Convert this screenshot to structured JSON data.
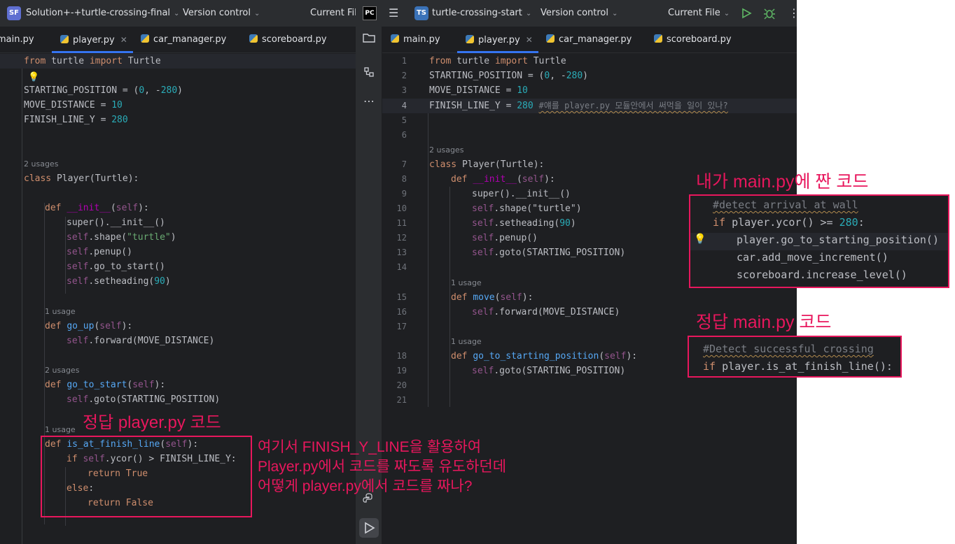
{
  "left": {
    "project_badge": "SF",
    "project_name": "Solution+-+turtle-crossing-final",
    "version_control": "Version control",
    "current_file": "Current Fil",
    "tabs": [
      {
        "label": "main.py"
      },
      {
        "label": "player.py",
        "active": true
      },
      {
        "label": "car_manager.py"
      },
      {
        "label": "scoreboard.py"
      }
    ],
    "hints": {
      "usages_2a": "2 usages",
      "usage_1": "1 usage",
      "usages_2b": "2 usages",
      "usage_1b": "1 usage"
    },
    "code": {
      "l1_a": "from",
      "l1_b": " turtle ",
      "l1_c": "import",
      "l1_d": " Turtle",
      "l3_a": "STARTING_POSITION = (",
      "l3_b": "0",
      "l3_c": ", -",
      "l3_d": "280",
      "l3_e": ")",
      "l4_a": "MOVE_DISTANCE = ",
      "l4_b": "10",
      "l5_a": "FINISH_LINE_Y = ",
      "l5_b": "280",
      "l8_a": "class",
      "l8_b": " Player(Turtle):",
      "l10_a": "def",
      "l10_b": "__init__",
      "l10_c": "(",
      "l10_d": "self",
      "l10_e": "):",
      "l11": "super().__init__()",
      "l12_a": "self",
      "l12_b": ".shape(",
      "l12_c": "\"turtle\"",
      "l12_d": ")",
      "l13_a": "self",
      "l13_b": ".penup()",
      "l14_a": "self",
      "l14_b": ".go_to_start()",
      "l15_a": "self",
      "l15_b": ".setheading(",
      "l15_c": "90",
      "l15_d": ")",
      "l17_a": "def",
      "l17_b": "go_up",
      "l17_c": "(",
      "l17_d": "self",
      "l17_e": "):",
      "l18_a": "self",
      "l18_b": ".forward(MOVE_DISTANCE)",
      "l20_a": "def",
      "l20_b": "go_to_start",
      "l20_c": "(",
      "l20_d": "self",
      "l20_e": "):",
      "l21_a": "self",
      "l21_b": ".goto(STARTING_POSITION)",
      "l23_a": "def",
      "l23_b": "is_at_finish_line",
      "l23_c": "(",
      "l23_d": "self",
      "l23_e": "):",
      "l24_a": "if",
      "l24_b": "self",
      "l24_c": ".ycor() > FINISH_LINE_Y:",
      "l25_a": "return",
      "l25_b": "True",
      "l26_a": "else",
      "l27_a": "return",
      "l27_b": "False"
    }
  },
  "right": {
    "app_badge": "PC",
    "project_badge": "TS",
    "project_name": "turtle-crossing-start",
    "version_control": "Version control",
    "current_file": "Current File",
    "tabs": [
      {
        "label": "main.py"
      },
      {
        "label": "player.py",
        "active": true
      },
      {
        "label": "car_manager.py"
      },
      {
        "label": "scoreboard.py"
      }
    ],
    "line_numbers": [
      "1",
      "2",
      "3",
      "4",
      "5",
      "6",
      "7",
      "8",
      "9",
      "10",
      "11",
      "12",
      "13",
      "14",
      "15",
      "16",
      "17",
      "18",
      "19",
      "20",
      "21"
    ],
    "hints": {
      "usages_2": "2 usages",
      "usage_1a": "1 usage",
      "usage_1b": "1 usage"
    },
    "code": {
      "l1_a": "from",
      "l1_b": " turtle ",
      "l1_c": "import",
      "l1_d": " Turtle",
      "l2_a": "STARTING_POSITION = (",
      "l2_b": "0",
      "l2_c": ", -",
      "l2_d": "280",
      "l2_e": ")",
      "l3_a": "MOVE_DISTANCE = ",
      "l3_b": "10",
      "l4_a": "FINISH_LINE_Y = ",
      "l4_b": "280",
      "l4_c": "#얘를 player.py 모듈안에서 써먹을 일이 있나?",
      "l7_a": "class",
      "l7_b": " Player(Turtle):",
      "l8_a": "def",
      "l8_b": "__init__",
      "l8_c": "(",
      "l8_d": "self",
      "l8_e": "):",
      "l9": "super().__init__()",
      "l10_a": "self",
      "l10_b": ".shape(\"turtle\")",
      "l11_a": "self",
      "l11_b": ".setheading(",
      "l11_c": "90",
      "l11_d": ")",
      "l12_a": "self",
      "l12_b": ".penup()",
      "l13_a": "self",
      "l13_b": ".goto(STARTING_POSITION)",
      "l15_a": "def",
      "l15_b": "move",
      "l15_c": "(",
      "l15_d": "self",
      "l15_e": "):",
      "l16_a": "self",
      "l16_b": ".forward(MOVE_DISTANCE)",
      "l18_a": "def",
      "l18_b": "go_to_starting_position",
      "l18_c": "(",
      "l18_d": "self",
      "l18_e": "):",
      "l19_a": "self",
      "l19_b": ".goto(STARTING_POSITION)"
    }
  },
  "annotations": {
    "answer_player_label": "정답 player.py 코드",
    "question_line1": "여기서 FINISH_Y_LINE을 활용하여",
    "question_line2": "Player.py에서 코드를 짜도록 유도하던데",
    "question_line3": "어떻게 player.py에서 코드를 짜나?",
    "my_main_label": "내가 main.py에 짠 코드",
    "answer_main_label": "정답 main.py 코드"
  },
  "my_main_snippet": {
    "l1": "#detect arrival at wall",
    "l2_a": "if",
    "l2_b": " player.ycor() >= ",
    "l2_c": "280",
    "l2_d": ":",
    "l3": "player.go_to_starting_position()",
    "l4": "car.add_move_increment()",
    "l5": "scoreboard.increase_level()"
  },
  "answer_main_snippet": {
    "l1": "#Detect successful crossing",
    "l2_a": "if",
    "l2_b": " player.is_at_finish_line():"
  },
  "colors": {
    "accent": "#3574f0",
    "annotation": "#e8175d"
  }
}
